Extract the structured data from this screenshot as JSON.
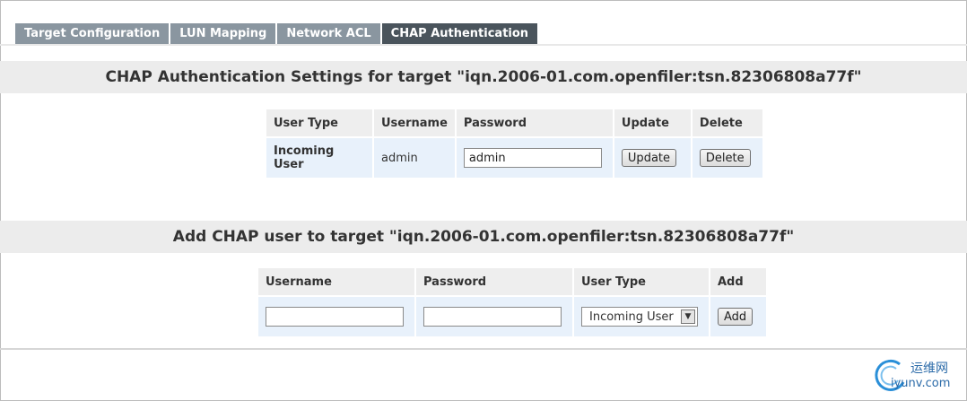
{
  "tabs": [
    {
      "label": "Target Configuration",
      "active": false
    },
    {
      "label": "LUN Mapping",
      "active": false
    },
    {
      "label": "Network ACL",
      "active": false
    },
    {
      "label": "CHAP Authentication",
      "active": true
    }
  ],
  "settings": {
    "title": "CHAP Authentication Settings for target \"iqn.2006-01.com.openfiler:tsn.82306808a77f\"",
    "headers": [
      "User Type",
      "Username",
      "Password",
      "Update",
      "Delete"
    ],
    "row": {
      "user_type": "Incoming User",
      "username": "admin",
      "password_value": "admin",
      "update_label": "Update",
      "delete_label": "Delete"
    }
  },
  "add_user": {
    "title": "Add CHAP user to target \"iqn.2006-01.com.openfiler:tsn.82306808a77f\"",
    "headers": [
      "Username",
      "Password",
      "User Type",
      "Add"
    ],
    "username_value": "",
    "password_value": "",
    "user_type_selected": "Incoming User",
    "add_label": "Add"
  },
  "watermark": {
    "line1": "运维网",
    "line2": "iyunv.com"
  },
  "colors": {
    "tab": "#8a96a0",
    "tab_active": "#4a545c",
    "header_band": "#ececec",
    "cell_bg": "#e8f1fb"
  }
}
